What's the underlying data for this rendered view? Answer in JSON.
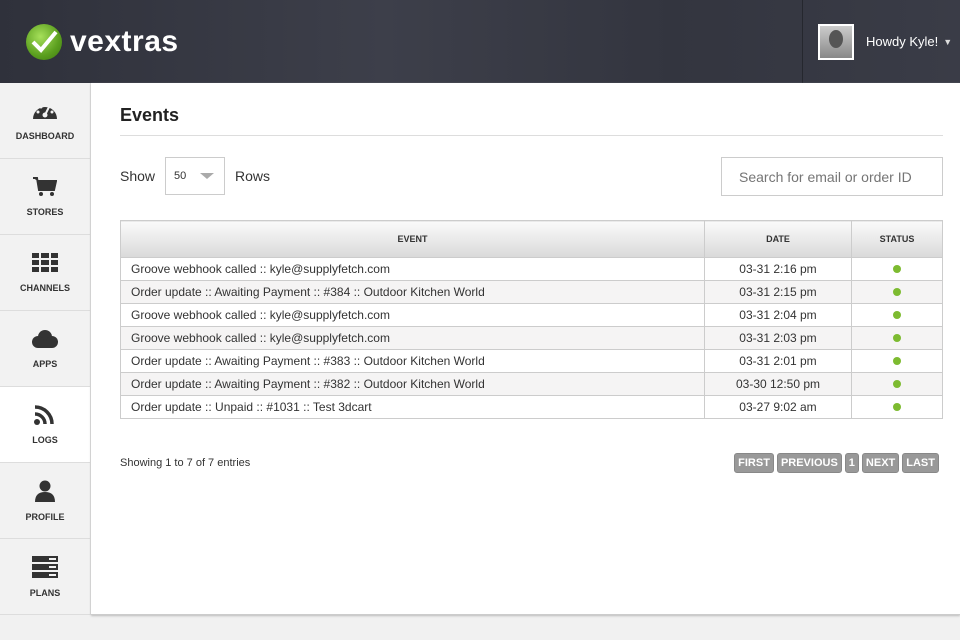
{
  "header": {
    "brand": "vextras",
    "greeting": "Howdy Kyle!",
    "accent": "#6fb12a"
  },
  "sidebar": {
    "items": [
      {
        "label": "DASHBOARD",
        "icon": "dashboard-icon"
      },
      {
        "label": "STORES",
        "icon": "cart-icon"
      },
      {
        "label": "CHANNELS",
        "icon": "grid-icon"
      },
      {
        "label": "APPS",
        "icon": "cloud-icon"
      },
      {
        "label": "LOGS",
        "icon": "rss-icon",
        "active": true
      },
      {
        "label": "PROFILE",
        "icon": "user-icon"
      },
      {
        "label": "PLANS",
        "icon": "server-icon"
      }
    ]
  },
  "main": {
    "title": "Events",
    "show_label": "Show",
    "rows_value": "50",
    "rows_label": "Rows",
    "search_placeholder": "Search for email or order ID",
    "columns": [
      "EVENT",
      "DATE",
      "STATUS"
    ],
    "rows": [
      {
        "event": "Groove webhook called :: kyle@supplyfetch.com",
        "date": "03-31 2:16 pm",
        "status": "ok"
      },
      {
        "event": "Order update :: Awaiting Payment :: #384 :: Outdoor Kitchen World",
        "date": "03-31 2:15 pm",
        "status": "ok"
      },
      {
        "event": "Groove webhook called :: kyle@supplyfetch.com",
        "date": "03-31 2:04 pm",
        "status": "ok"
      },
      {
        "event": "Groove webhook called :: kyle@supplyfetch.com",
        "date": "03-31 2:03 pm",
        "status": "ok"
      },
      {
        "event": "Order update :: Awaiting Payment :: #383 :: Outdoor Kitchen World",
        "date": "03-31 2:01 pm",
        "status": "ok"
      },
      {
        "event": "Order update :: Awaiting Payment :: #382 :: Outdoor Kitchen World",
        "date": "03-30 12:50 pm",
        "status": "ok"
      },
      {
        "event": "Order update :: Unpaid :: #1031 :: Test 3dcart",
        "date": "03-27 9:02 am",
        "status": "ok"
      }
    ],
    "info": "Showing 1 to 7 of 7 entries",
    "pager": [
      "FIRST",
      "PREVIOUS",
      "1",
      "NEXT",
      "LAST"
    ]
  }
}
